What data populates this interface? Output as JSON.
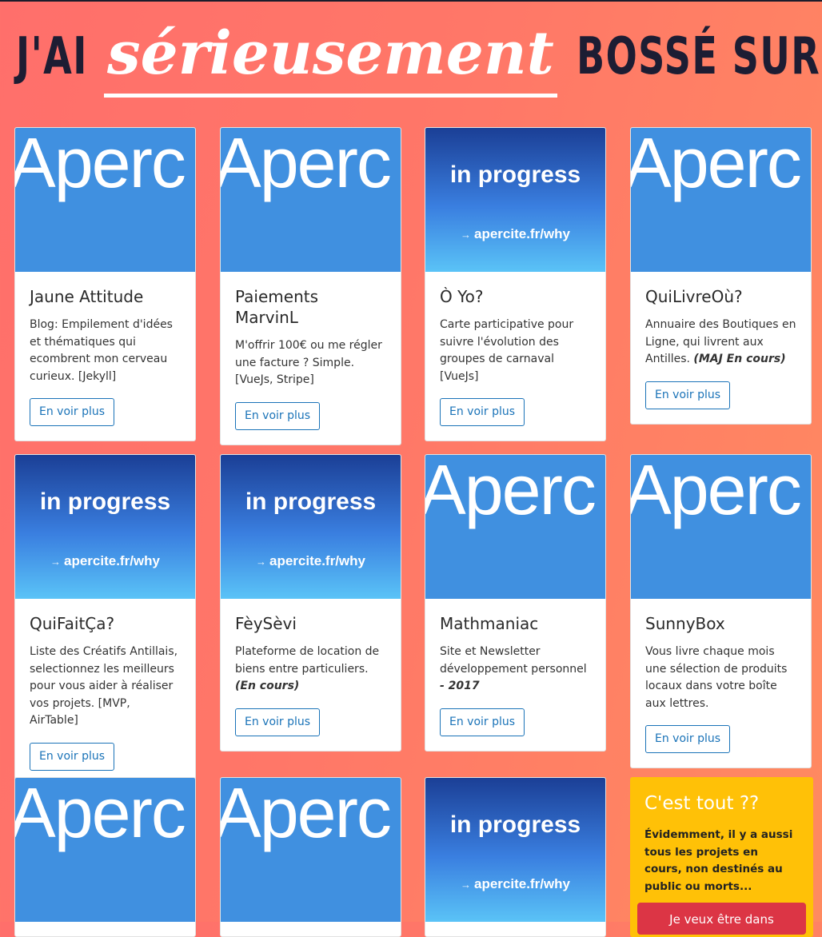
{
  "header": {
    "title_part1": "J'AI",
    "title_emphasis": "sérieusement",
    "title_part2": "BOSSÉ SUR :"
  },
  "thumbnails": {
    "aperc_text": "Aperc",
    "progress_text": "in progress",
    "progress_link": "apercite.fr/why",
    "arrow": "→"
  },
  "projects": [
    {
      "title": "Jaune Attitude",
      "desc": "Blog: Empilement d'idées et thématiques qui ecombrent mon cerveau curieux. [Jekyll]",
      "note": "",
      "button": "En voir plus",
      "thumb": "aperc"
    },
    {
      "title": "Paiements MarvinL",
      "desc": "M'offrir 100€ ou me régler une facture ? Simple. [VueJs, Stripe]",
      "note": "",
      "button": "En voir plus",
      "thumb": "aperc"
    },
    {
      "title": "Ò Yo?",
      "desc": "Carte participative pour suivre l'évolution des groupes de carnaval [VueJs]",
      "note": "",
      "button": "En voir plus",
      "thumb": "progress"
    },
    {
      "title": "QuiLivreOù?",
      "desc": "Annuaire des Boutiques en Ligne, qui livrent aux Antilles.",
      "note": "(MAJ En cours)",
      "button": "En voir plus",
      "thumb": "aperc"
    },
    {
      "title": "QuiFaitÇa?",
      "desc": "Liste des Créatifs Antillais, selectionnez les meilleurs pour vous aider à réaliser vos projets. [MVP, AirTable]",
      "note": "",
      "button": "En voir plus",
      "thumb": "progress"
    },
    {
      "title": "FèySèvi",
      "desc": "Plateforme de location de biens entre particuliers.",
      "note": "(En cours)",
      "button": "En voir plus",
      "thumb": "progress"
    },
    {
      "title": "Mathmaniac",
      "desc": "Site et Newsletter développement personnel",
      "note": "- 2017",
      "button": "En voir plus",
      "thumb": "aperc"
    },
    {
      "title": "SunnyBox",
      "desc": "Vous livre chaque mois une sélection de produits locaux dans votre boîte aux lettres.",
      "note": "",
      "button": "En voir plus",
      "thumb": "aperc"
    }
  ],
  "extra_thumbs": [
    "aperc",
    "aperc",
    "progress"
  ],
  "promo": {
    "title": "C'est tout ??",
    "text": "Évidemment, il y a aussi tous les projets en cours, non destinés au public ou morts...",
    "button": "Je veux être dans"
  }
}
